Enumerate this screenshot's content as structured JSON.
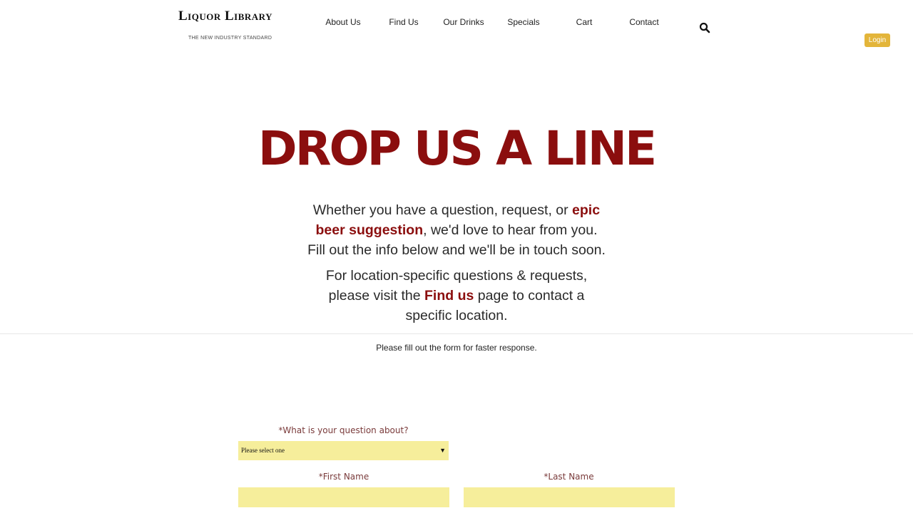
{
  "header": {
    "logo_title": "Liquor Library",
    "logo_tagline": "THE NEW INDUSTRY STANDARD",
    "nav": [
      "About Us",
      "Find Us",
      "Our Drinks",
      "Specials",
      "Cart",
      "Contact"
    ],
    "search_icon": "search-icon",
    "login_label": "Login",
    "login_color": "#e3b53a"
  },
  "hero": {
    "title": "DROP US A LINE",
    "title_color": "#8b0e0e",
    "p1_before": "Whether you have a question, request, or ",
    "p1_highlight": "epic beer suggestion",
    "p1_after": ", we'd love to hear from you. Fill out the info below and we'll be in touch soon.",
    "p2_before": "For location-specific questions & requests, please visit the ",
    "p2_link": "Find us",
    "p2_after": " page to contact a specific location."
  },
  "form": {
    "note": "Please fill out the form for faster response.",
    "question_label": "*What is your question about?",
    "question_value": "Please select one",
    "first_name_label": "*First Name",
    "first_name_value": "",
    "last_name_label": "*Last Name",
    "last_name_value": "",
    "field_color": "#f6ee9b"
  }
}
